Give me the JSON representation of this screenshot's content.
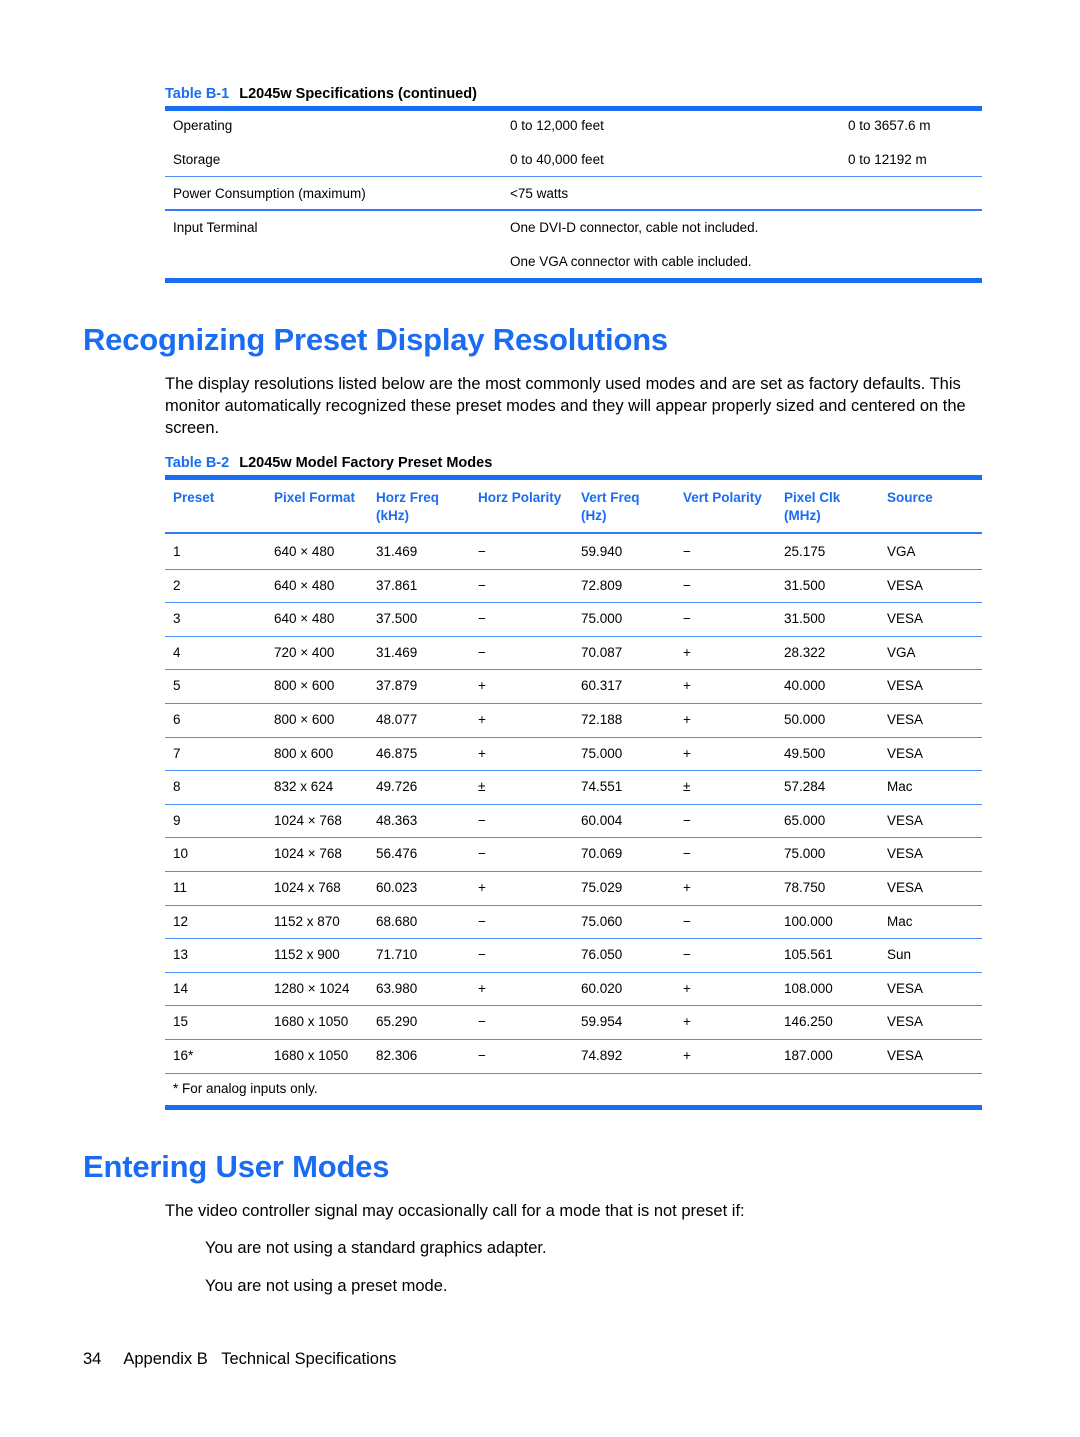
{
  "table_b1": {
    "caption_number": "Table B-1",
    "caption_title": "L2045w Specifications (continued)",
    "rows": [
      {
        "label": "Operating",
        "value": "0 to 12,000 feet",
        "metric": "0 to 3657.6 m"
      },
      {
        "label": "Storage",
        "value": "0 to 40,000 feet",
        "metric": "0 to 12192 m"
      },
      {
        "label": "Power Consumption (maximum)",
        "value": "<75 watts",
        "metric": ""
      },
      {
        "label": "Input Terminal",
        "value": "One DVI-D connector, cable not included.",
        "metric": ""
      },
      {
        "label": "",
        "value": "One VGA connector with cable included.",
        "metric": ""
      }
    ]
  },
  "section1": {
    "heading": "Recognizing Preset Display Resolutions",
    "paragraph": "The display resolutions listed below are the most commonly used modes and are set as factory defaults. This monitor automatically recognized these preset modes and they will appear properly sized and centered on the screen."
  },
  "table_b2": {
    "caption_number": "Table B-2",
    "caption_title": "L2045w Model Factory Preset Modes",
    "headers": [
      {
        "line1": "Preset",
        "line2": ""
      },
      {
        "line1": "Pixel Format",
        "line2": ""
      },
      {
        "line1": "Horz Freq",
        "line2": "(kHz)"
      },
      {
        "line1": "Horz Polarity",
        "line2": ""
      },
      {
        "line1": "Vert Freq",
        "line2": "(Hz)"
      },
      {
        "line1": "Vert Polarity",
        "line2": ""
      },
      {
        "line1": "Pixel Clk",
        "line2": "(MHz)"
      },
      {
        "line1": "Source",
        "line2": ""
      }
    ],
    "rows": [
      [
        "1",
        "640 × 480",
        "31.469",
        "−",
        "59.940",
        "−",
        "25.175",
        "VGA"
      ],
      [
        "2",
        "640 × 480",
        "37.861",
        "−",
        "72.809",
        "−",
        "31.500",
        "VESA"
      ],
      [
        "3",
        "640 × 480",
        "37.500",
        "−",
        "75.000",
        "−",
        "31.500",
        "VESA"
      ],
      [
        "4",
        "720 × 400",
        "31.469",
        "−",
        "70.087",
        "+",
        "28.322",
        "VGA"
      ],
      [
        "5",
        "800 × 600",
        "37.879",
        "+",
        "60.317",
        "+",
        "40.000",
        "VESA"
      ],
      [
        "6",
        "800 × 600",
        "48.077",
        "+",
        "72.188",
        "+",
        "50.000",
        "VESA"
      ],
      [
        "7",
        "800 x 600",
        "46.875",
        "+",
        "75.000",
        "+",
        "49.500",
        "VESA"
      ],
      [
        "8",
        "832 x 624",
        "49.726",
        "±",
        "74.551",
        "±",
        "57.284",
        "Mac"
      ],
      [
        "9",
        "1024 × 768",
        "48.363",
        "−",
        "60.004",
        "−",
        "65.000",
        "VESA"
      ],
      [
        "10",
        "1024 × 768",
        "56.476",
        "−",
        "70.069",
        "−",
        "75.000",
        "VESA"
      ],
      [
        "11",
        "1024 x 768",
        "60.023",
        "+",
        "75.029",
        "+",
        "78.750",
        "VESA"
      ],
      [
        "12",
        "1152 x 870",
        "68.680",
        "−",
        "75.060",
        "−",
        "100.000",
        "Mac"
      ],
      [
        "13",
        "1152 x 900",
        "71.710",
        "−",
        "76.050",
        "−",
        "105.561",
        "Sun"
      ],
      [
        "14",
        "1280 × 1024",
        "63.980",
        "+",
        "60.020",
        "+",
        "108.000",
        "VESA"
      ],
      [
        "15",
        "1680 x 1050",
        "65.290",
        "−",
        "59.954",
        "+",
        "146.250",
        "VESA"
      ],
      [
        "16*",
        "1680 x 1050",
        "82.306",
        "−",
        "74.892",
        "+",
        "187.000",
        "VESA"
      ]
    ],
    "footnote": "* For analog inputs only."
  },
  "section2": {
    "heading": "Entering User Modes",
    "paragraph": "The video controller signal may occasionally call for a mode that is not preset if:",
    "bullets": [
      "You are not using a standard graphics adapter.",
      "You are not using a preset mode."
    ]
  },
  "footer": {
    "page_number": "34",
    "section_title": "Appendix B   Technical Specifications"
  },
  "colors": {
    "accent_blue": "#1a6cf2"
  }
}
